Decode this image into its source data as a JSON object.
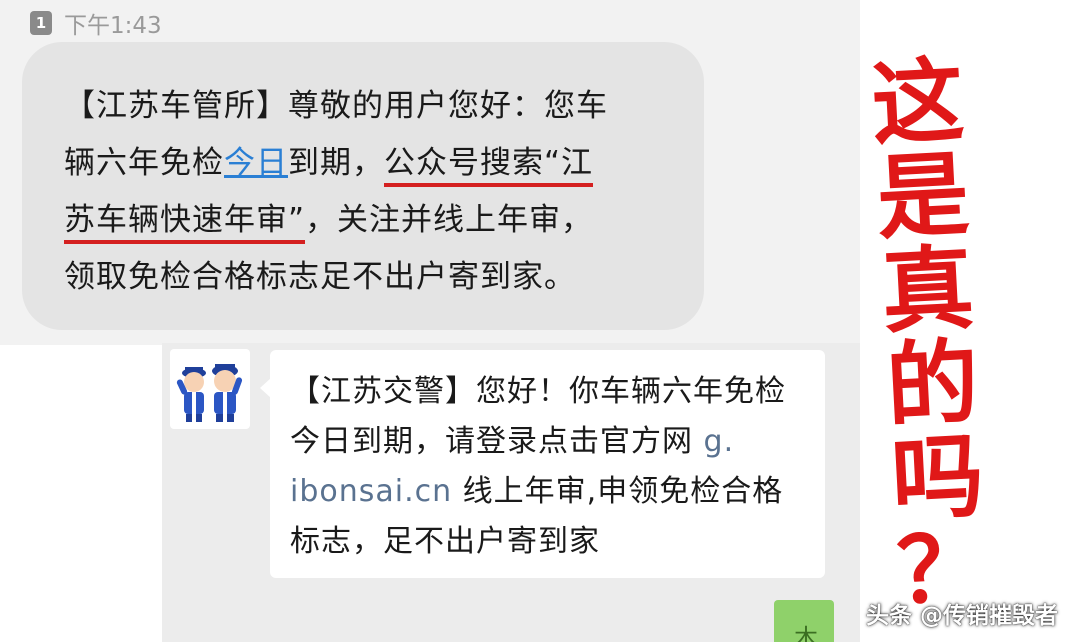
{
  "status": {
    "sim_label": "1",
    "time": "下午1:43"
  },
  "message1": {
    "line1": "【江苏车管所】尊敬的用户您好：您车",
    "line2_pre": "辆六年免检",
    "line2_link": "今日",
    "line2_mid": "到期，",
    "line2_underlined": "公众号搜索“江",
    "line3_underlined": "苏车辆快速年审”",
    "line3_rest": "，关注并线上年审，",
    "line4": "领取免检合格标志足不出户寄到家。"
  },
  "message2": {
    "line1": "【江苏交警】您好！你车辆六年免检",
    "line2_pre": "今日到期，请登录点击官方网 ",
    "line2_link": "g.",
    "line3_link": "ibonsai.cn",
    "line3_rest": " 线上年审,申领免检合格",
    "line4": "标志，足不出户寄到家"
  },
  "avatar": {
    "icon": "police-officers-icon"
  },
  "annotation": {
    "chars": [
      "这",
      "是",
      "真",
      "的",
      "吗"
    ],
    "question": "？"
  },
  "watermark": "头条 @传销摧毁者",
  "colors": {
    "annotation_red": "#e01818",
    "link_blue": "#2a7fd4",
    "underline_red": "#d42020",
    "send_green": "#8fd16a"
  }
}
